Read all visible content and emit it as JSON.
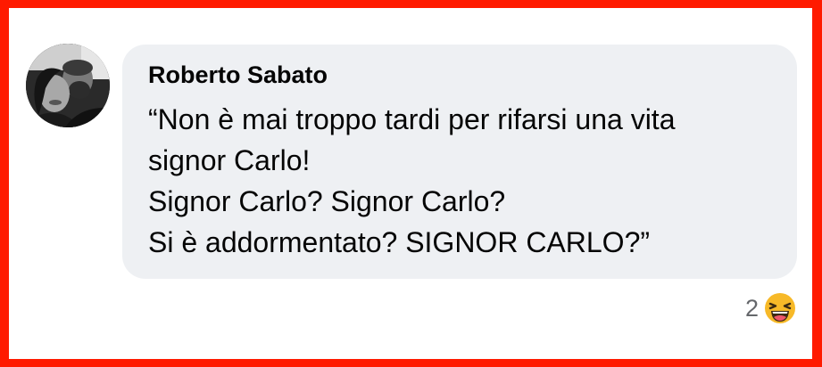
{
  "comment": {
    "author": "Roberto Sabato",
    "lines": [
      "“Non è mai troppo tardi per rifarsi una vita",
      "signor Carlo!",
      "Signor Carlo? Signor Carlo?",
      "Si è addormentato? SIGNOR CARLO?”"
    ],
    "avatar_icon": "profile-photo",
    "reaction_count": "2",
    "reaction_icon": "laughing-emoji"
  },
  "colors": {
    "border": "#ff1a00",
    "bubble": "#eef0f3",
    "text": "#050505",
    "meta": "#65676b"
  }
}
